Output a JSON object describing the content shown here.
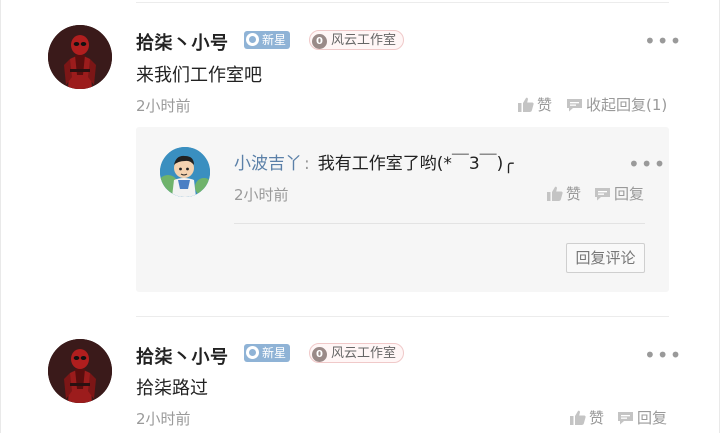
{
  "comments": [
    {
      "username": "拾柒丶小号",
      "badge_new": "新星",
      "badge_studio_level": "0",
      "badge_studio": "风云工作室",
      "text": "来我们工作室吧",
      "time": "2小时前",
      "like_label": "赞",
      "collapse_label": "收起回复(1)",
      "replies": [
        {
          "username": "小波吉丫",
          "colon": ":",
          "text": "我有工作室了哟(*￣3￣)╭",
          "time": "2小时前",
          "like_label": "赞",
          "reply_label": "回复"
        }
      ],
      "reply_comment_button": "回复评论"
    },
    {
      "username": "拾柒丶小号",
      "badge_new": "新星",
      "badge_studio_level": "0",
      "badge_studio": "风云工作室",
      "text": "拾柒路过",
      "time": "2小时前",
      "like_label": "赞",
      "reply_label": "回复"
    }
  ],
  "icons": {
    "more": "more-dots-icon",
    "like": "thumbs-up-icon",
    "reply": "speech-bubble-icon",
    "badge_new": "star-badge-icon"
  },
  "colors": {
    "reply_username": "#5b80a8",
    "badge_new_bg": "#8fb3d6",
    "meta_gray": "#9a9a9a",
    "reply_box_bg": "#f6f6f6"
  }
}
